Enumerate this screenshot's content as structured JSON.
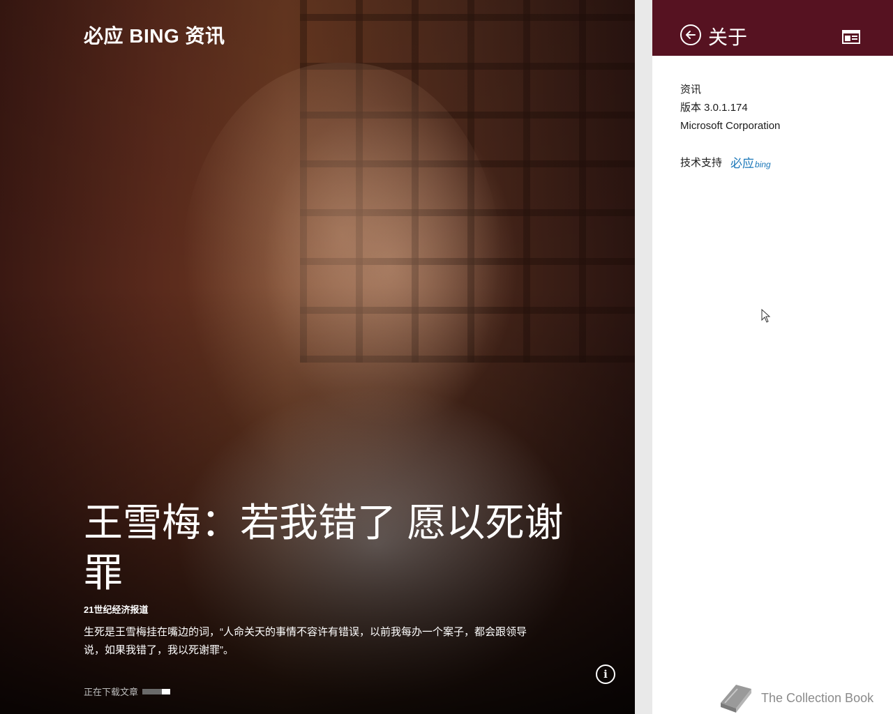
{
  "hero": {
    "app_title": "必应 BING 资讯",
    "headline": "王雪梅：若我错了 愿以死谢罪",
    "source": "21世纪经济报道",
    "summary": "生死是王雪梅挂在嘴边的词，“人命关天的事情不容许有错误，以前我每办一个案子，都会跟领导说，如果我错了，我以死谢罪”。",
    "status_text": "正在下载文章",
    "download_progress": 0.3,
    "info_icon": "info-icon"
  },
  "flyout": {
    "title": "关于",
    "back_icon": "back-arrow-icon",
    "app_icon": "app-window-icon",
    "app_name": "资讯",
    "version": "版本 3.0.1.174",
    "publisher": "Microsoft Corporation",
    "support_label": "技术支持",
    "support_logo_cn": "必应",
    "support_logo_en": "bing",
    "header_color": "#561221",
    "logo_color": "#1976b8"
  },
  "watermark": {
    "text": "The Collection Book",
    "icon": "book-icon"
  }
}
